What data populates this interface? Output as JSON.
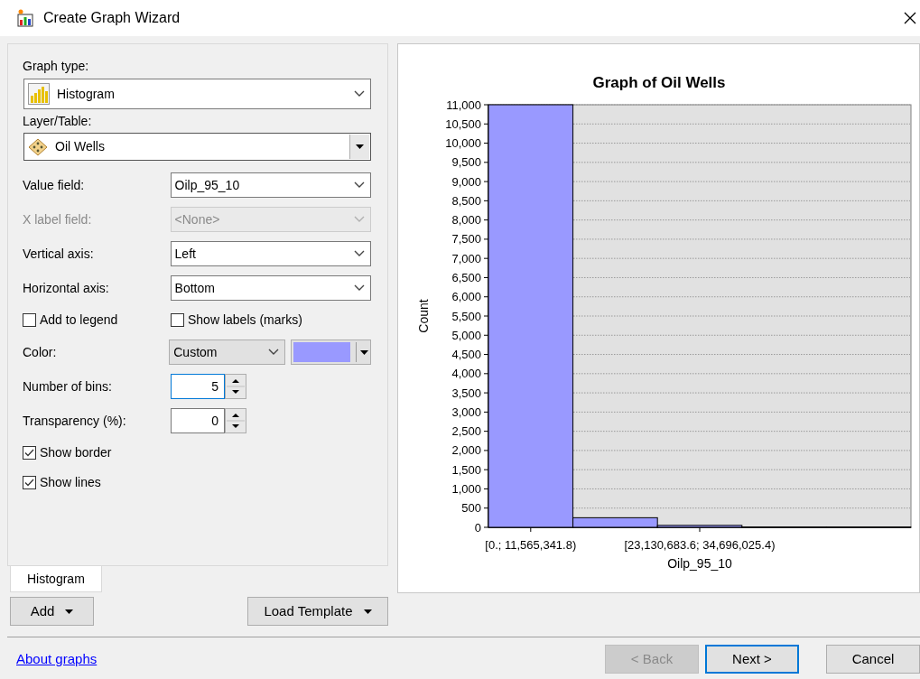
{
  "window": {
    "title": "Create Graph Wizard"
  },
  "graph_type": {
    "label": "Graph type:",
    "value": "Histogram"
  },
  "layer": {
    "label": "Layer/Table:",
    "value": "Oil Wells"
  },
  "fields": [
    {
      "kind": "select",
      "label": "Value field:",
      "value": "Oilp_95_10",
      "disabled": false
    },
    {
      "kind": "select",
      "label": "X label field:",
      "value": "<None>",
      "disabled": true
    },
    {
      "kind": "select",
      "label": "Vertical axis:",
      "value": "Left",
      "disabled": false
    },
    {
      "kind": "select",
      "label": "Horizontal axis:",
      "value": "Bottom",
      "disabled": false
    },
    {
      "kind": "checkpair",
      "items": [
        {
          "label": "Add to legend",
          "checked": false
        },
        {
          "label": "Show labels (marks)",
          "checked": false
        }
      ]
    },
    {
      "kind": "color",
      "label": "Color:",
      "value": "Custom",
      "color": "#9999ff"
    },
    {
      "kind": "spin",
      "label": "Number of bins:",
      "value": "5",
      "focused": true
    },
    {
      "kind": "spin",
      "label": "Transparency (%):",
      "value": "0",
      "focused": false
    },
    {
      "kind": "checkbox",
      "label": "Show border",
      "checked": true
    },
    {
      "kind": "checkbox",
      "label": "Show lines",
      "checked": true
    }
  ],
  "tabs": [
    {
      "label": "Histogram",
      "selected": true
    }
  ],
  "panel_buttons": [
    "Add",
    "Load Template"
  ],
  "chart": {
    "chart_data": {
      "type": "bar",
      "title": "Graph of Oil Wells",
      "xlabel": "Oilp_95_10",
      "ylabel": "Count",
      "categories": [
        "[0.; 11,565,341.8)",
        null,
        "[23,130,683.6; 34,696,025.4)",
        null,
        null
      ],
      "values": [
        11000,
        250,
        50,
        0,
        0
      ],
      "grid": true,
      "ylim": [
        0,
        11000
      ],
      "yticks": [
        {
          "value": 0,
          "label": "0"
        },
        {
          "value": 500,
          "label": "500"
        },
        {
          "value": 1000,
          "label": "1,000"
        },
        {
          "value": 1500,
          "label": "1,500"
        },
        {
          "value": 2000,
          "label": "2,000"
        },
        {
          "value": 2500,
          "label": "2,500"
        },
        {
          "value": 3000,
          "label": "3,000"
        },
        {
          "value": 3500,
          "label": "3,500"
        },
        {
          "value": 4000,
          "label": "4,000"
        },
        {
          "value": 4500,
          "label": "4,500"
        },
        {
          "value": 5000,
          "label": "5,000"
        },
        {
          "value": 5500,
          "label": "5,500"
        },
        {
          "value": 6000,
          "label": "6,000"
        },
        {
          "value": 6500,
          "label": "6,500"
        },
        {
          "value": 7000,
          "label": "7,000"
        },
        {
          "value": 7500,
          "label": "7,500"
        },
        {
          "value": 8000,
          "label": "8,000"
        },
        {
          "value": 8500,
          "label": "8,500"
        },
        {
          "value": 9000,
          "label": "9,000"
        },
        {
          "value": 9500,
          "label": "9,500"
        },
        {
          "value": 10000,
          "label": "10,000"
        },
        {
          "value": 10500,
          "label": "10,500"
        },
        {
          "value": 11000,
          "label": "11,000"
        }
      ]
    }
  },
  "footer": {
    "link": "About graphs",
    "buttons": [
      {
        "label": "< Back",
        "disabled": true,
        "default": false
      },
      {
        "label": "Next >",
        "disabled": false,
        "default": true
      },
      {
        "label": "Cancel",
        "disabled": false,
        "default": false
      }
    ]
  }
}
